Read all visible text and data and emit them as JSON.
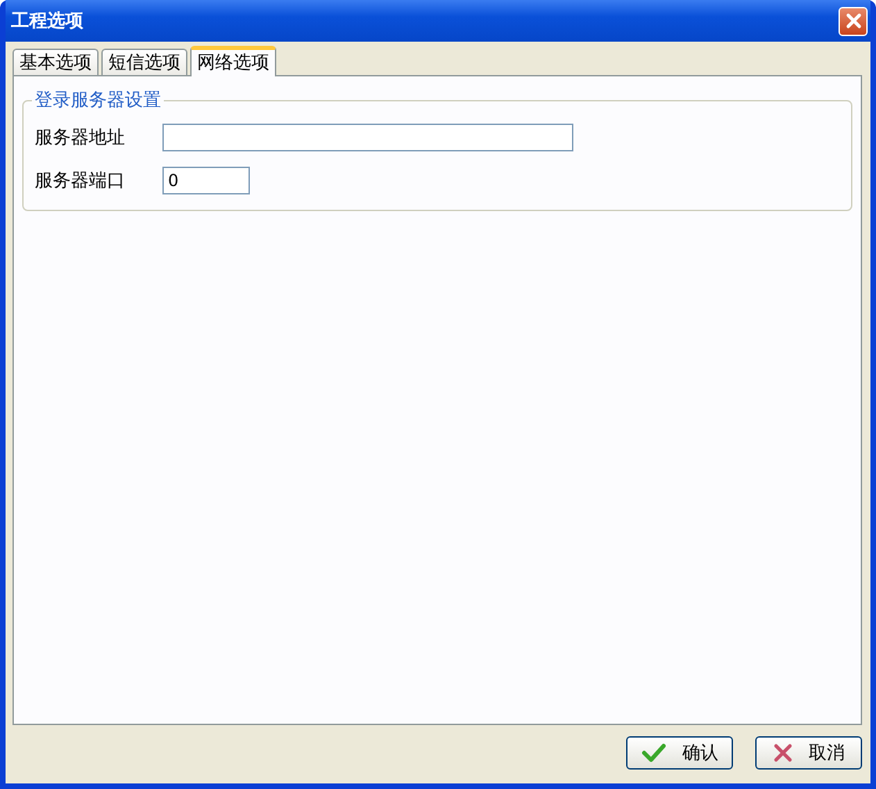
{
  "window": {
    "title": "工程选项"
  },
  "tabs": [
    {
      "label": "基本选项",
      "selected": false
    },
    {
      "label": "短信选项",
      "selected": false
    },
    {
      "label": "网络选项",
      "selected": true
    }
  ],
  "group": {
    "title": "登录服务器设置",
    "fields": [
      {
        "label": "服务器地址"
      },
      {
        "label": "服务器端口",
        "value": "0"
      }
    ]
  },
  "buttons": [
    {
      "label": "确认",
      "kind": "ok"
    },
    {
      "label": "取消",
      "kind": "cancel"
    }
  ]
}
